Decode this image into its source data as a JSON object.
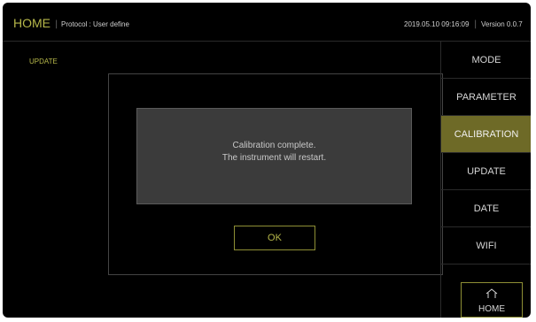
{
  "header": {
    "home_title": "HOME",
    "separator": "|",
    "protocol": "Protocol : User define",
    "datetime": "2019.05.10 09:16:09",
    "version": "Version 0.0.7"
  },
  "content": {
    "section_title": "UPDATE",
    "dialog": {
      "message_line1": "Calibration complete.",
      "message_line2": "The instrument will restart.",
      "ok_label": "OK"
    }
  },
  "sidebar": {
    "items": [
      {
        "label": "MODE",
        "active": false
      },
      {
        "label": "PARAMETER",
        "active": false
      },
      {
        "label": "CALIBRATION",
        "active": true
      },
      {
        "label": "UPDATE",
        "active": false
      },
      {
        "label": "DATE",
        "active": false
      },
      {
        "label": "WIFI",
        "active": false
      }
    ],
    "home_button": {
      "label": "HOME",
      "icon": "home-icon"
    }
  },
  "colors": {
    "accent": "#b7b84a",
    "active_bg": "#6e6a27",
    "background": "#000000",
    "dialog_bg": "#3b3b3b"
  }
}
